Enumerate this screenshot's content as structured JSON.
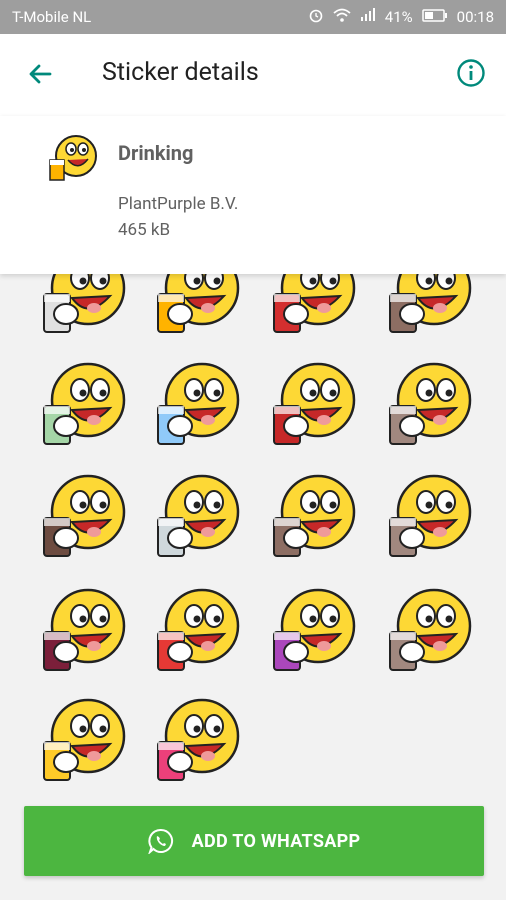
{
  "status_bar": {
    "carrier": "T-Mobile  NL",
    "battery": "41%",
    "time": "00:18"
  },
  "header": {
    "title": "Sticker details",
    "back_icon": "arrow-back-icon",
    "info_icon": "info-icon"
  },
  "pack": {
    "name": "Drinking",
    "publisher": "PlantPurple B.V.",
    "size": "465 kB"
  },
  "stickers": [
    {
      "name": "cocktail-glass-sticker"
    },
    {
      "name": "sipping-straw-sticker"
    },
    {
      "name": "beer-pong-sticker"
    },
    {
      "name": "bar-stools-sticker"
    },
    {
      "name": "mojito-sticker"
    },
    {
      "name": "blonde-bar-sticker"
    },
    {
      "name": "redhead-wine-sticker"
    },
    {
      "name": "whiskey-glass-sticker"
    },
    {
      "name": "beer-bottle-sticker"
    },
    {
      "name": "martini-sticker"
    },
    {
      "name": "coconut-drink-sticker"
    },
    {
      "name": "whiskey-cheers-sticker"
    },
    {
      "name": "red-wine-sticker"
    },
    {
      "name": "red-cocktail-sticker"
    },
    {
      "name": "shots-sticker"
    },
    {
      "name": "iced-tea-sticker"
    },
    {
      "name": "beer-glass-sticker"
    },
    {
      "name": "rainbow-cocktail-sticker"
    }
  ],
  "action": {
    "label": "ADD TO WHATSAPP",
    "icon": "whatsapp-icon"
  },
  "colors": {
    "accent": "#00897b",
    "button": "#4cb640",
    "smiley": "#fdd835"
  }
}
